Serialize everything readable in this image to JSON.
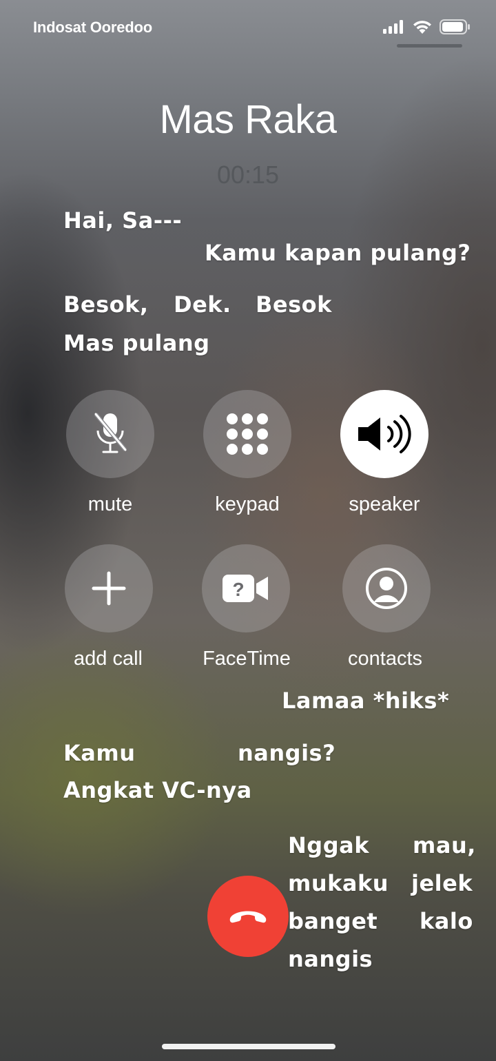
{
  "status_bar": {
    "carrier": "Indosat Ooredoo",
    "icons": [
      "signal-icon",
      "wifi-icon",
      "battery-icon"
    ]
  },
  "call": {
    "caller_name": "Mas Raka",
    "duration": "00:15"
  },
  "controls": {
    "mute": "mute",
    "keypad": "keypad",
    "speaker": "speaker",
    "add_call": "add call",
    "facetime": "FaceTime",
    "contacts": "contacts"
  },
  "overlay_text": {
    "line1": "Hai, Sa---",
    "line2": "Kamu kapan pulang?",
    "line3a": "Besok,",
    "line3b": "Dek.",
    "line3c": "Besok",
    "line4": "Mas pulang",
    "line5": "Lamaa *hiks*",
    "line6a": "Kamu",
    "line6b": "nangis?",
    "line7": "Angkat VC-nya",
    "line8a": "Nggak",
    "line8b": "mau,",
    "line9a": "mukaku",
    "line9b": "jelek",
    "line10a": "banget",
    "line10b": "kalo",
    "line11": "nangis"
  },
  "colors": {
    "end_call": "#f04135",
    "button_bg": "rgba(200,200,205,0.28)",
    "speaker_active": "#ffffff"
  }
}
